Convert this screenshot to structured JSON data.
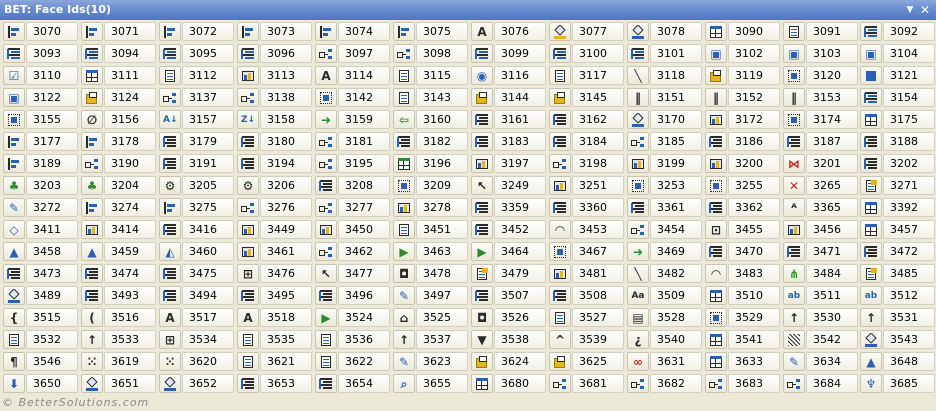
{
  "window": {
    "title": "BET: Face Ids(10)",
    "menu_arrow": "▼",
    "close": "✕"
  },
  "footer": "© BetterSolutions.com",
  "colors": {
    "icon_blue": "#2b5fb3",
    "icon_dark": "#2a2a2a",
    "icon_red": "#c8261d",
    "icon_green": "#2f8a2f",
    "icon_yellow": "#e6b422"
  },
  "grid": [
    [
      {
        "id": "3070",
        "icon": "align-icon"
      },
      {
        "id": "3071",
        "icon": "align-right-icon"
      },
      {
        "id": "3072",
        "icon": "align-top-icon"
      },
      {
        "id": "3073",
        "icon": "align-bottom-icon"
      },
      {
        "id": "3074",
        "icon": "center-icon"
      },
      {
        "id": "3075",
        "icon": "distribute-icon"
      },
      {
        "id": "3076",
        "icon": "font-a-icon"
      },
      {
        "id": "3077",
        "icon": "fill-color-icon"
      },
      {
        "id": "3078",
        "icon": "line-color-icon"
      },
      {
        "id": "3090",
        "icon": "sheet-icon"
      },
      {
        "id": "3091",
        "icon": "web-icon"
      },
      {
        "id": "3092",
        "icon": "bars-icon"
      }
    ],
    [
      {
        "id": "3093",
        "icon": "bars-icon"
      },
      {
        "id": "3094",
        "icon": "bars-icon"
      },
      {
        "id": "3095",
        "icon": "bars-icon"
      },
      {
        "id": "3096",
        "icon": "bars-icon"
      },
      {
        "id": "3097",
        "icon": "connector-icon"
      },
      {
        "id": "3098",
        "icon": "connector-icon"
      },
      {
        "id": "3099",
        "icon": "bars-icon"
      },
      {
        "id": "3100",
        "icon": "bars-icon"
      },
      {
        "id": "3101",
        "icon": "bars-icon"
      },
      {
        "id": "3102",
        "icon": "save-icon"
      },
      {
        "id": "3103",
        "icon": "save-icon"
      },
      {
        "id": "3104",
        "icon": "save-icon"
      }
    ],
    [
      {
        "id": "3110",
        "icon": "checkbox-icon"
      },
      {
        "id": "3111",
        "icon": "table-icon"
      },
      {
        "id": "3112",
        "icon": "button-icon"
      },
      {
        "id": "3113",
        "icon": "picture-icon"
      },
      {
        "id": "3114",
        "icon": "font-a-icon"
      },
      {
        "id": "3115",
        "icon": "listbox-icon"
      },
      {
        "id": "3116",
        "icon": "radio-icon"
      },
      {
        "id": "3117",
        "icon": "textbox-icon"
      },
      {
        "id": "3118",
        "icon": "line-icon"
      },
      {
        "id": "3119",
        "icon": "folder-icon"
      },
      {
        "id": "3120",
        "icon": "frame-icon"
      },
      {
        "id": "3121",
        "icon": "xml-icon"
      }
    ],
    [
      {
        "id": "3122",
        "icon": "save-icon"
      },
      {
        "id": "3124",
        "icon": "open-icon"
      },
      {
        "id": "3137",
        "icon": "connector-icon"
      },
      {
        "id": "3138",
        "icon": "connector-icon"
      },
      {
        "id": "3142",
        "icon": "crop-icon"
      },
      {
        "id": "3143",
        "icon": "textbox-icon"
      },
      {
        "id": "3144",
        "icon": "paste-icon"
      },
      {
        "id": "3145",
        "icon": "copy-icon"
      },
      {
        "id": "3151",
        "icon": "divider-icon"
      },
      {
        "id": "3152",
        "icon": "divider-icon"
      },
      {
        "id": "3153",
        "icon": "divider-icon"
      },
      {
        "id": "3154",
        "icon": "bars-icon"
      }
    ],
    [
      {
        "id": "3155",
        "icon": "dotted-box-icon"
      },
      {
        "id": "3156",
        "icon": "paperclip-icon"
      },
      {
        "id": "3157",
        "icon": "sort-az-icon"
      },
      {
        "id": "3158",
        "icon": "sort-za-icon"
      },
      {
        "id": "3159",
        "icon": "arrow-right-icon"
      },
      {
        "id": "3160",
        "icon": "arrow-left-icon"
      },
      {
        "id": "3161",
        "icon": "list-icon"
      },
      {
        "id": "3162",
        "icon": "list-icon"
      },
      {
        "id": "3170",
        "icon": "paint-icon"
      },
      {
        "id": "3172",
        "icon": "chart-icon"
      },
      {
        "id": "3174",
        "icon": "dotted-box-icon"
      },
      {
        "id": "3175",
        "icon": "table-icon"
      }
    ],
    [
      {
        "id": "3177",
        "icon": "indent-icon"
      },
      {
        "id": "3178",
        "icon": "indent-icon"
      },
      {
        "id": "3179",
        "icon": "list-icon"
      },
      {
        "id": "3180",
        "icon": "list-icon"
      },
      {
        "id": "3181",
        "icon": "connector-icon"
      },
      {
        "id": "3182",
        "icon": "list-icon"
      },
      {
        "id": "3183",
        "icon": "list-icon"
      },
      {
        "id": "3184",
        "icon": "list-icon"
      },
      {
        "id": "3185",
        "icon": "connector-icon"
      },
      {
        "id": "3186",
        "icon": "list-icon"
      },
      {
        "id": "3187",
        "icon": "list-icon"
      },
      {
        "id": "3188",
        "icon": "list-icon"
      }
    ],
    [
      {
        "id": "3189",
        "icon": "indent-icon"
      },
      {
        "id": "3190",
        "icon": "connector-icon"
      },
      {
        "id": "3191",
        "icon": "list-icon"
      },
      {
        "id": "3194",
        "icon": "list-icon"
      },
      {
        "id": "3195",
        "icon": "connector-icon"
      },
      {
        "id": "3196",
        "icon": "excel-icon"
      },
      {
        "id": "3197",
        "icon": "globe-icon"
      },
      {
        "id": "3198",
        "icon": "connector-icon"
      },
      {
        "id": "3199",
        "icon": "group-icon"
      },
      {
        "id": "3200",
        "icon": "group-icon"
      },
      {
        "id": "3201",
        "icon": "merge-icon"
      },
      {
        "id": "3202",
        "icon": "list-icon"
      }
    ],
    [
      {
        "id": "3203",
        "icon": "add-user-icon"
      },
      {
        "id": "3204",
        "icon": "add-user-icon"
      },
      {
        "id": "3205",
        "icon": "gear-icon"
      },
      {
        "id": "3206",
        "icon": "gear-icon"
      },
      {
        "id": "3208",
        "icon": "list-icon"
      },
      {
        "id": "3209",
        "icon": "dotted-box-icon"
      },
      {
        "id": "3249",
        "icon": "pointer-icon"
      },
      {
        "id": "3251",
        "icon": "chart-icon"
      },
      {
        "id": "3253",
        "icon": "dotted-box-icon"
      },
      {
        "id": "3255",
        "icon": "dotted-box-icon"
      },
      {
        "id": "3265",
        "icon": "delete-x-icon"
      },
      {
        "id": "3271",
        "icon": "note-icon"
      }
    ],
    [
      {
        "id": "3272",
        "icon": "edit-icon"
      },
      {
        "id": "3274",
        "icon": "indent-icon"
      },
      {
        "id": "3275",
        "icon": "indent-icon"
      },
      {
        "id": "3276",
        "icon": "connector-icon"
      },
      {
        "id": "3277",
        "icon": "connector-icon"
      },
      {
        "id": "3278",
        "icon": "shapes-icon"
      },
      {
        "id": "3359",
        "icon": "list-icon"
      },
      {
        "id": "3360",
        "icon": "list-icon"
      },
      {
        "id": "3361",
        "icon": "list-icon"
      },
      {
        "id": "3362",
        "icon": "list-icon"
      },
      {
        "id": "3365",
        "icon": "superscript-icon"
      },
      {
        "id": "3392",
        "icon": "table-icon"
      }
    ],
    [
      {
        "id": "3411",
        "icon": "eraser-icon"
      },
      {
        "id": "3414",
        "icon": "chart-icon"
      },
      {
        "id": "3416",
        "icon": "list-icon"
      },
      {
        "id": "3449",
        "icon": "shapes-icon"
      },
      {
        "id": "3450",
        "icon": "shapes-icon"
      },
      {
        "id": "3451",
        "icon": "textbox-icon"
      },
      {
        "id": "3452",
        "icon": "list-icon"
      },
      {
        "id": "3453",
        "icon": "curve-icon"
      },
      {
        "id": "3454",
        "icon": "connector-icon"
      },
      {
        "id": "3455",
        "icon": "nodes-icon"
      },
      {
        "id": "3456",
        "icon": "shapes-icon"
      },
      {
        "id": "3457",
        "icon": "table-icon"
      }
    ],
    [
      {
        "id": "3458",
        "icon": "triangle-icon"
      },
      {
        "id": "3459",
        "icon": "triangle-icon"
      },
      {
        "id": "3460",
        "icon": "flip-icon"
      },
      {
        "id": "3461",
        "icon": "shapes-icon"
      },
      {
        "id": "3462",
        "icon": "connector-icon"
      },
      {
        "id": "3463",
        "icon": "play-icon"
      },
      {
        "id": "3464",
        "icon": "play-icon"
      },
      {
        "id": "3467",
        "icon": "frame-icon"
      },
      {
        "id": "3469",
        "icon": "arrow-right-icon"
      },
      {
        "id": "3470",
        "icon": "list-icon"
      },
      {
        "id": "3471",
        "icon": "list-icon"
      },
      {
        "id": "3472",
        "icon": "list-icon"
      }
    ],
    [
      {
        "id": "3473",
        "icon": "list-icon"
      },
      {
        "id": "3474",
        "icon": "list-icon"
      },
      {
        "id": "3475",
        "icon": "list-icon"
      },
      {
        "id": "3476",
        "icon": "grid-icon"
      },
      {
        "id": "3477",
        "icon": "pointer-icon"
      },
      {
        "id": "3478",
        "icon": "speech-icon"
      },
      {
        "id": "3479",
        "icon": "note-icon"
      },
      {
        "id": "3481",
        "icon": "chart-icon"
      },
      {
        "id": "3482",
        "icon": "line-icon"
      },
      {
        "id": "3483",
        "icon": "curve-icon"
      },
      {
        "id": "3484",
        "icon": "org-chart-icon"
      },
      {
        "id": "3485",
        "icon": "note-icon"
      }
    ],
    [
      {
        "id": "3489",
        "icon": "paint-icon"
      },
      {
        "id": "3493",
        "icon": "list-icon"
      },
      {
        "id": "3494",
        "icon": "list-icon"
      },
      {
        "id": "3495",
        "icon": "list-icon"
      },
      {
        "id": "3496",
        "icon": "list-icon"
      },
      {
        "id": "3497",
        "icon": "edit-icon"
      },
      {
        "id": "3507",
        "icon": "list-icon"
      },
      {
        "id": "3508",
        "icon": "list-icon"
      },
      {
        "id": "3509",
        "icon": "font-size-icon"
      },
      {
        "id": "3510",
        "icon": "calendar-icon"
      },
      {
        "id": "3511",
        "icon": "spelling-icon"
      },
      {
        "id": "3512",
        "icon": "spelling-icon"
      }
    ],
    [
      {
        "id": "3515",
        "icon": "brace-icon"
      },
      {
        "id": "3516",
        "icon": "paren-icon"
      },
      {
        "id": "3517",
        "icon": "font-a-icon"
      },
      {
        "id": "3518",
        "icon": "font-a-icon"
      },
      {
        "id": "3524",
        "icon": "play-icon"
      },
      {
        "id": "3525",
        "icon": "home-icon"
      },
      {
        "id": "3526",
        "icon": "speech-icon"
      },
      {
        "id": "3527",
        "icon": "page-icon"
      },
      {
        "id": "3528",
        "icon": "film-icon"
      },
      {
        "id": "3529",
        "icon": "frame-icon"
      },
      {
        "id": "3530",
        "icon": "arrow-up-icon"
      },
      {
        "id": "3531",
        "icon": "arrow-up-icon"
      }
    ],
    [
      {
        "id": "3532",
        "icon": "page-icon"
      },
      {
        "id": "3533",
        "icon": "arrow-up-icon"
      },
      {
        "id": "3534",
        "icon": "grid-icon"
      },
      {
        "id": "3535",
        "icon": "page-icon"
      },
      {
        "id": "3536",
        "icon": "page-icon"
      },
      {
        "id": "3537",
        "icon": "arrow-up-icon"
      },
      {
        "id": "3538",
        "icon": "filter-icon"
      },
      {
        "id": "3539",
        "icon": "caret-icon"
      },
      {
        "id": "3540",
        "icon": "question-icon"
      },
      {
        "id": "3541",
        "icon": "calendar-icon"
      },
      {
        "id": "3542",
        "icon": "pattern-icon"
      },
      {
        "id": "3543",
        "icon": "paint-icon"
      }
    ],
    [
      {
        "id": "3546",
        "icon": "pilcrow-icon"
      },
      {
        "id": "3619",
        "icon": "dots-icon"
      },
      {
        "id": "3620",
        "icon": "dots-icon"
      },
      {
        "id": "3621",
        "icon": "page-icon"
      },
      {
        "id": "3622",
        "icon": "page-icon"
      },
      {
        "id": "3623",
        "icon": "edit-icon"
      },
      {
        "id": "3624",
        "icon": "paste-icon"
      },
      {
        "id": "3625",
        "icon": "paste-icon"
      },
      {
        "id": "3631",
        "icon": "link-icon"
      },
      {
        "id": "3633",
        "icon": "calendar-icon"
      },
      {
        "id": "3634",
        "icon": "edit-icon"
      },
      {
        "id": "3648",
        "icon": "triangle-icon"
      }
    ],
    [
      {
        "id": "3650",
        "icon": "arrow-down-icon"
      },
      {
        "id": "3651",
        "icon": "paint-icon"
      },
      {
        "id": "3652",
        "icon": "paint-icon"
      },
      {
        "id": "3653",
        "icon": "list-icon"
      },
      {
        "id": "3654",
        "icon": "list-icon"
      },
      {
        "id": "3655",
        "icon": "search-icon"
      },
      {
        "id": "3680",
        "icon": "table-icon"
      },
      {
        "id": "3681",
        "icon": "connector-icon"
      },
      {
        "id": "3682",
        "icon": "connector-icon"
      },
      {
        "id": "3683",
        "icon": "connector-icon"
      },
      {
        "id": "3684",
        "icon": "connector-icon"
      },
      {
        "id": "3685",
        "icon": "tree-icon"
      }
    ]
  ]
}
